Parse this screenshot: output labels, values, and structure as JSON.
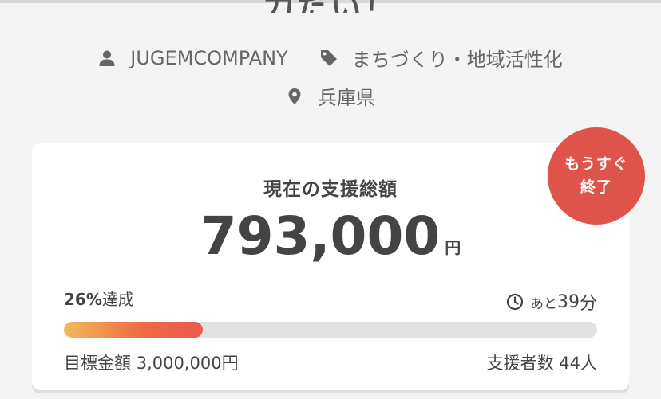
{
  "project": {
    "title_partial": "力だい！",
    "owner": "JUGEMCOMPANY",
    "category": "まちづくり・地域活性化",
    "location": "兵庫県"
  },
  "funding": {
    "heading": "現在の支援総額",
    "amount": "793,000",
    "currency": "円",
    "badge_line1": "もうすぐ",
    "badge_line2": "終了",
    "achievement_percent": "26%",
    "achievement_suffix": "達成",
    "progress_fraction": 0.26,
    "remaining_prefix": "あと",
    "remaining_value": "39",
    "remaining_unit": "分",
    "goal_label": "目標金額",
    "goal_amount": "3,000,000円",
    "supporters_label": "支援者数",
    "supporters_count": "44人"
  },
  "icons": {
    "owner": "user-icon",
    "category": "tag-icon",
    "location": "map-pin-icon",
    "remaining": "clock-icon"
  },
  "colors": {
    "badge": "#de544b",
    "bar_start": "#f3bb5a",
    "bar_end": "#eb5a4d"
  }
}
